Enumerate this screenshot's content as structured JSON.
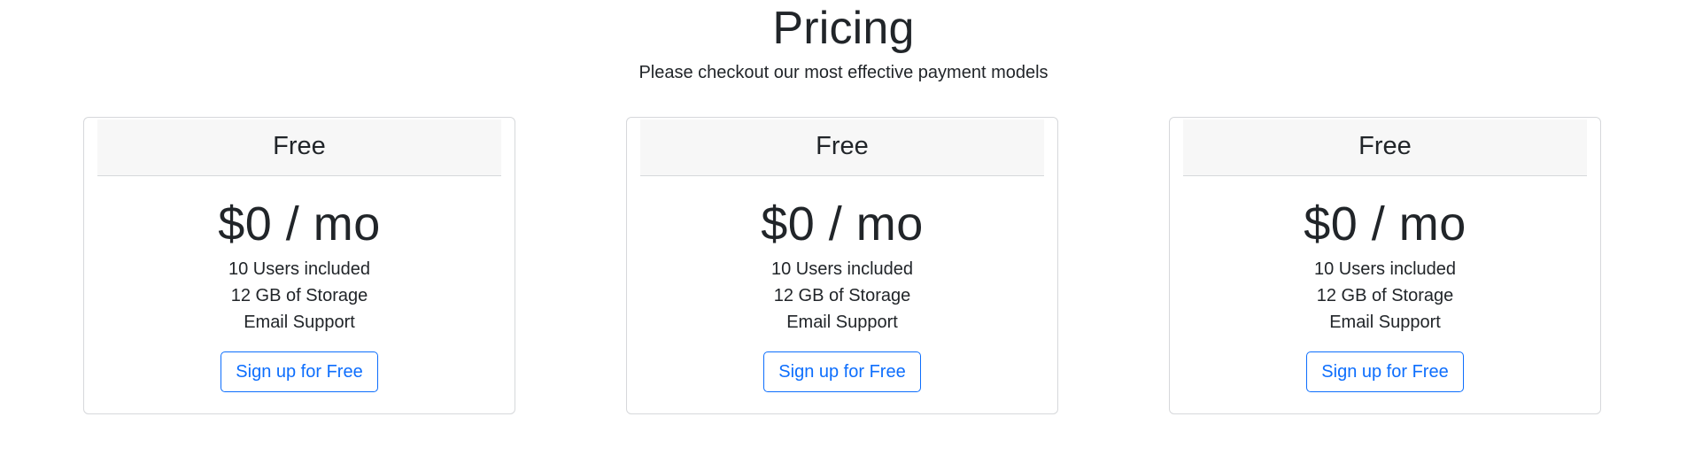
{
  "header": {
    "title": "Pricing",
    "subtitle": "Please checkout our most effective payment models"
  },
  "plans": [
    {
      "name": "Free",
      "price": "$0 / mo",
      "features": [
        "10 Users included",
        "12 GB of Storage",
        "Email Support"
      ],
      "button_label": "Sign up for Free"
    },
    {
      "name": "Free",
      "price": "$0 / mo",
      "features": [
        "10 Users included",
        "12 GB of Storage",
        "Email Support"
      ],
      "button_label": "Sign up for Free"
    },
    {
      "name": "Free",
      "price": "$0 / mo",
      "features": [
        "10 Users included",
        "12 GB of Storage",
        "Email Support"
      ],
      "button_label": "Sign up for Free"
    }
  ],
  "colors": {
    "accent": "#0d6efd",
    "text": "#212529",
    "card_header_bg": "#f7f7f7",
    "border": "#d6d8db"
  }
}
